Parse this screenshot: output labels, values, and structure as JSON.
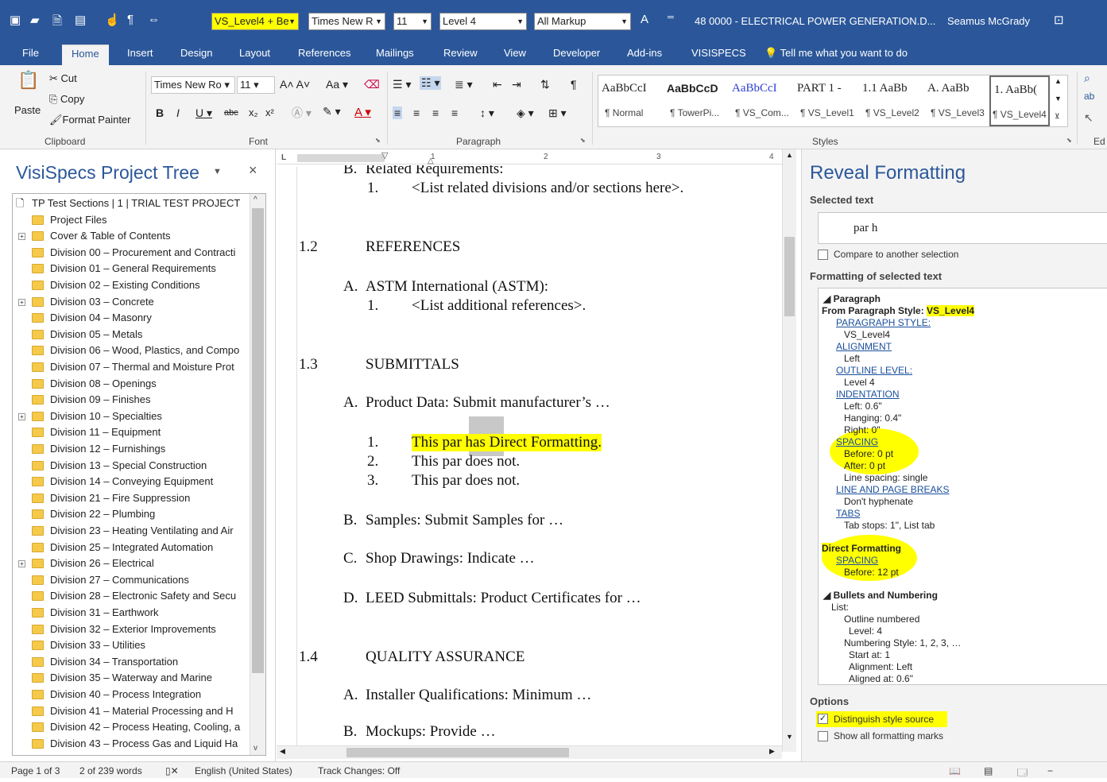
{
  "qat": {
    "style_box": "VS_Level4 + Be",
    "font_box": "Times New R",
    "size_box": "11",
    "level_box": "Level 4",
    "markup_box": "All Markup",
    "doc_title": "48 0000 - ELECTRICAL POWER GENERATION.D...",
    "user": "Seamus McGrady"
  },
  "tabs": [
    "File",
    "Home",
    "Insert",
    "Design",
    "Layout",
    "References",
    "Mailings",
    "Review",
    "View",
    "Developer",
    "Add-ins",
    "VISISPECS"
  ],
  "tell_me": "Tell me what you want to do",
  "ribbon": {
    "clipboard": {
      "paste": "Paste",
      "cut": "Cut",
      "copy": "Copy",
      "format_painter": "Format Painter",
      "label": "Clipboard"
    },
    "font": {
      "name": "Times New Ro",
      "size": "11",
      "label": "Font"
    },
    "paragraph": {
      "label": "Paragraph"
    },
    "styles": {
      "label": "Styles",
      "items": [
        {
          "preview": "AaBbCcI",
          "name": "¶ Normal"
        },
        {
          "preview": "AaBbCcD",
          "name": "¶ TowerPi..."
        },
        {
          "preview": "AaBbCcI",
          "name": "¶ VS_Com..."
        },
        {
          "preview": "PART 1 -",
          "name": "¶ VS_Level1"
        },
        {
          "preview": "1.1 AaBb",
          "name": "¶ VS_Level2"
        },
        {
          "preview": "A. AaBb",
          "name": "¶ VS_Level3"
        },
        {
          "preview": "1. AaBb(",
          "name": "¶ VS_Level4"
        }
      ]
    },
    "editing_label": "Ed"
  },
  "left_panel": {
    "title": "VisiSpecs Project Tree",
    "nodes": [
      {
        "label": "TP Test Sections | 1 | TRIAL TEST PROJECT",
        "root": true
      },
      {
        "label": "Project Files"
      },
      {
        "label": "Cover & Table of Contents",
        "plus": true
      },
      {
        "label": "Division 00 – Procurement and Contracti"
      },
      {
        "label": "Division 01 – General Requirements"
      },
      {
        "label": "Division 02 – Existing Conditions"
      },
      {
        "label": "Division 03 – Concrete",
        "plus": true
      },
      {
        "label": "Division 04 – Masonry"
      },
      {
        "label": "Division 05 – Metals"
      },
      {
        "label": "Division 06 – Wood, Plastics, and Compo"
      },
      {
        "label": "Division 07 – Thermal and Moisture Prot"
      },
      {
        "label": "Division 08 – Openings"
      },
      {
        "label": "Division 09 – Finishes"
      },
      {
        "label": "Division 10 – Specialties",
        "plus": true
      },
      {
        "label": "Division 11 – Equipment"
      },
      {
        "label": "Division 12 – Furnishings"
      },
      {
        "label": "Division 13 – Special Construction"
      },
      {
        "label": "Division 14 – Conveying Equipment"
      },
      {
        "label": "Division 21 – Fire Suppression"
      },
      {
        "label": "Division 22 – Plumbing"
      },
      {
        "label": "Division 23 – Heating Ventilating and Air"
      },
      {
        "label": "Division 25 – Integrated Automation"
      },
      {
        "label": "Division 26 – Electrical",
        "plus": true
      },
      {
        "label": "Division 27 – Communications"
      },
      {
        "label": "Division 28 – Electronic Safety and Secu"
      },
      {
        "label": "Division 31 – Earthwork"
      },
      {
        "label": "Division 32 – Exterior Improvements"
      },
      {
        "label": "Division 33 – Utilities"
      },
      {
        "label": "Division 34 – Transportation"
      },
      {
        "label": "Division 35 – Waterway and Marine"
      },
      {
        "label": "Division 40 – Process Integration"
      },
      {
        "label": "Division 41 – Material Processing and H"
      },
      {
        "label": "Division 42 – Process Heating, Cooling, a"
      },
      {
        "label": "Division 43 – Process Gas and Liquid Ha"
      }
    ]
  },
  "document": {
    "ruler_marks": [
      "1",
      "2",
      "3",
      "4"
    ],
    "lines": [
      {
        "num": "B.",
        "text": "Related Requirements:"
      },
      {
        "num": "1.",
        "text": "<List related divisions and/or sections here>."
      },
      {
        "num": "1.2",
        "text": "REFERENCES"
      },
      {
        "num": "A.",
        "text": "ASTM International (ASTM):"
      },
      {
        "num": "1.",
        "text": "<List additional references>."
      },
      {
        "num": "1.3",
        "text": "SUBMITTALS"
      },
      {
        "num": "A.",
        "text": "Product Data: Submit manufacturer’s …"
      },
      {
        "num": "1.",
        "text": "This par has Direct Formatting."
      },
      {
        "num": "2.",
        "text": "This par does not."
      },
      {
        "num": "3.",
        "text": "This par does not."
      },
      {
        "num": "B.",
        "text": "Samples: Submit Samples for …"
      },
      {
        "num": "C.",
        "text": "Shop Drawings: Indicate …"
      },
      {
        "num": "D.",
        "text": "LEED Submittals:  Product Certificates for …"
      },
      {
        "num": "1.4",
        "text": "QUALITY ASSURANCE"
      },
      {
        "num": "A.",
        "text": "Installer Qualifications:  Minimum …"
      },
      {
        "num": "B.",
        "text": "Mockups:  Provide …"
      }
    ]
  },
  "reveal": {
    "title": "Reveal Formatting",
    "selected_label": "Selected text",
    "selected_text": "par h",
    "compare": "Compare to another selection",
    "formatting_label": "Formatting of selected text",
    "lines": [
      {
        "t": "◢ Paragraph",
        "c": "b"
      },
      {
        "t": "From Paragraph Style: ",
        "c": "b"
      },
      {
        "t": "VS_Level4",
        "c": "b"
      },
      {
        "t": "PARAGRAPH STYLE:",
        "c": "lnk"
      },
      {
        "t": "VS_Level4",
        "c": ""
      },
      {
        "t": "ALIGNMENT",
        "c": "lnk"
      },
      {
        "t": "Left",
        "c": ""
      },
      {
        "t": "OUTLINE LEVEL:",
        "c": "lnk"
      },
      {
        "t": "Level 4",
        "c": ""
      },
      {
        "t": "INDENTATION",
        "c": "lnk"
      },
      {
        "t": "Left:  0.6\"",
        "c": ""
      },
      {
        "t": "Hanging:  0.4\"",
        "c": ""
      },
      {
        "t": "Right:  0\"",
        "c": ""
      },
      {
        "t": "SPACING",
        "c": "lnk"
      },
      {
        "t": "Before:  0 pt",
        "c": ""
      },
      {
        "t": "After:  0 pt",
        "c": ""
      },
      {
        "t": "Line spacing:  single",
        "c": ""
      },
      {
        "t": "LINE AND PAGE BREAKS",
        "c": "lnk"
      },
      {
        "t": "Don't hyphenate",
        "c": ""
      },
      {
        "t": "TABS",
        "c": "lnk"
      },
      {
        "t": "Tab stops:  1\", List tab",
        "c": ""
      },
      {
        "t": "Direct Formatting",
        "c": "b"
      },
      {
        "t": "SPACING",
        "c": "lnk"
      },
      {
        "t": "Before:  12 pt",
        "c": ""
      },
      {
        "t": "◢ Bullets and Numbering",
        "c": "b"
      },
      {
        "t": "List:",
        "c": ""
      },
      {
        "t": "Outline numbered",
        "c": ""
      },
      {
        "t": "Level: 4",
        "c": ""
      },
      {
        "t": "Numbering Style:  1, 2, 3, …",
        "c": ""
      },
      {
        "t": "Start at: 1",
        "c": ""
      },
      {
        "t": "Alignment: Left",
        "c": ""
      },
      {
        "t": "Aligned at:  0.6\"",
        "c": ""
      }
    ],
    "options_label": "Options",
    "distinguish": "Distinguish style source",
    "show_marks": "Show all formatting marks",
    "highlight_color": "#ffff00"
  },
  "status": {
    "page": "Page 1 of 3",
    "words": "2 of 239 words",
    "language": "English (United States)",
    "track": "Track Changes: Off"
  }
}
